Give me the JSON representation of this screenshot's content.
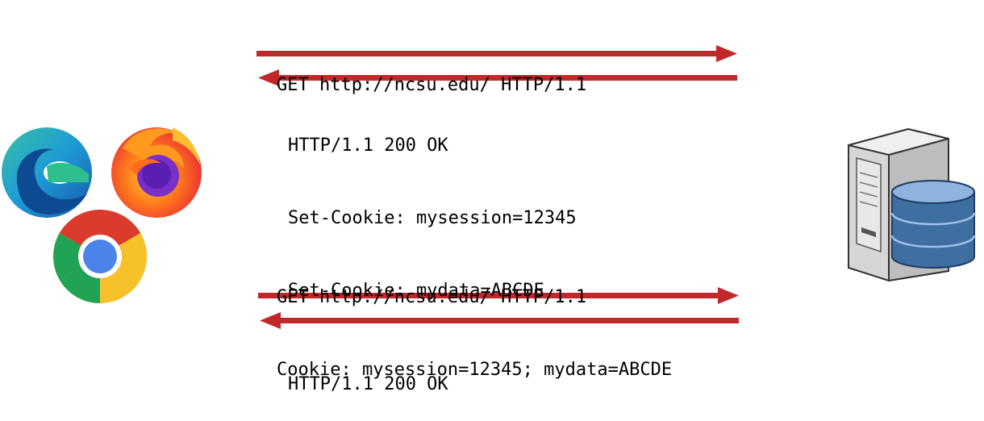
{
  "colors": {
    "arrow": "#c0282a",
    "server_body": "#e3e3e3",
    "database": "#3f6ea3"
  },
  "icons": {
    "browsers": [
      "edge-browser-icon",
      "firefox-browser-icon",
      "chrome-browser-icon"
    ],
    "server": "server-database-icon"
  },
  "exchanges": [
    {
      "direction": "request",
      "lines": [
        "GET http://ncsu.edu/ HTTP/1.1"
      ]
    },
    {
      "direction": "response",
      "lines": [
        "HTTP/1.1 200 OK",
        "Set-Cookie: mysession=12345",
        "Set-Cookie: mydata=ABCDE"
      ]
    },
    {
      "direction": "request",
      "lines": [
        "GET http://ncsu.edu/ HTTP/1.1",
        "Cookie: mysession=12345; mydata=ABCDE"
      ]
    },
    {
      "direction": "response",
      "lines": [
        "HTTP/1.1 200 OK"
      ]
    }
  ]
}
